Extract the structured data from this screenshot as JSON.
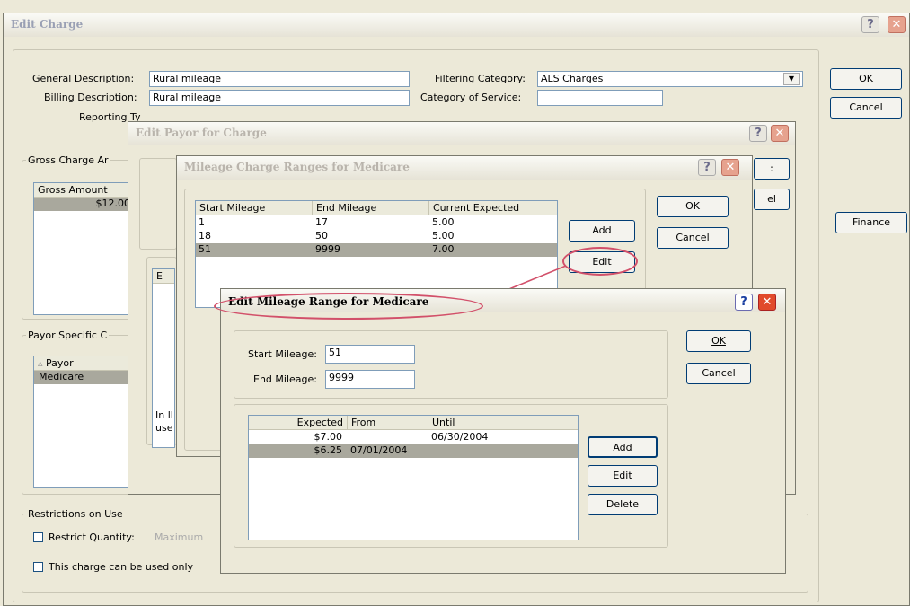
{
  "edit_charge": {
    "title": "Edit Charge",
    "general_description_label": "General Description:",
    "general_description_value": "Rural mileage",
    "billing_description_label": "Billing Description:",
    "billing_description_value": "Rural mileage",
    "reporting_label": "Reporting Ty",
    "filtering_category_label": "Filtering Category:",
    "filtering_category_value": "ALS Charges",
    "category_of_service_label": "Category of Service:",
    "category_of_service_value": "",
    "gross_group_label": "Gross Charge Ar",
    "gross_amount_header": "Gross Amount",
    "gross_amount_value": "$12.00",
    "payor_group_label": "Payor Specific C",
    "payor_header": "Payor",
    "payor_value": "Medicare",
    "restrictions_label": "Restrictions on Use",
    "restrict_quantity_label": "Restrict Quantity:",
    "restrict_quantity_hint": "Maximum",
    "charge_used_only_label": "This charge can be used only",
    "ok_label": "OK",
    "cancel_label": "Cancel",
    "finance_label": "Finance"
  },
  "edit_payor": {
    "title": "Edit Payor for Charge",
    "inner_label_line1": "In ll",
    "inner_label_line2": "use",
    "tab_fragment": "E"
  },
  "mileage_ranges": {
    "title": "Mileage Charge Ranges for Medicare",
    "columns": [
      "Start Mileage",
      "End Mileage",
      "Current Expected"
    ],
    "rows": [
      [
        "1",
        "17",
        "5.00"
      ],
      [
        "18",
        "50",
        "5.00"
      ],
      [
        "51",
        "9999",
        "7.00"
      ]
    ],
    "add_label": "Add",
    "edit_label": "Edit",
    "ok_label": "OK",
    "cancel_label": "Cancel"
  },
  "edit_mileage_range": {
    "title": "Edit Mileage Range for Medicare",
    "start_label": "Start Mileage:",
    "start_value": "51",
    "end_label": "End Mileage:",
    "end_value": "9999",
    "columns": [
      "Expected",
      "From",
      "Until"
    ],
    "rows": [
      [
        "$7.00",
        "",
        "06/30/2004"
      ],
      [
        "$6.25",
        "07/01/2004",
        ""
      ]
    ],
    "ok_label": "OK",
    "cancel_label": "Cancel",
    "add_label": "Add",
    "edit_label": "Edit",
    "delete_label": "Delete"
  },
  "colors": {
    "highlight_ellipse": "#d2506a",
    "selected_row": "#a9a89d",
    "close_button": "#e14a2b"
  }
}
